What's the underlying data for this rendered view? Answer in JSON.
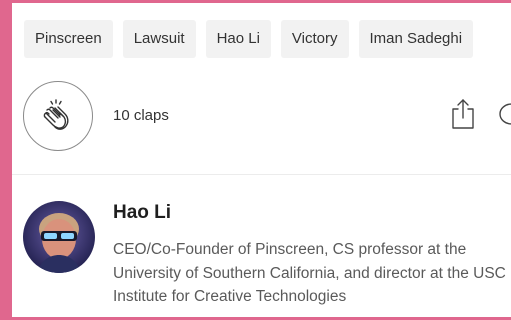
{
  "tags": [
    "Pinscreen",
    "Lawsuit",
    "Hao Li",
    "Victory",
    "Iman Sadeghi"
  ],
  "claps": {
    "count_label": "10 claps"
  },
  "icons": {
    "clap": "clap-hands-icon",
    "share": "share-icon",
    "comment": "comment-icon"
  },
  "author": {
    "name": "Hao Li",
    "bio": "CEO/Co-Founder of Pinscreen, CS professor at the University of Southern California, and director at the USC Institute for Creative Technologies"
  },
  "colors": {
    "frame": "#e0678e",
    "tag_bg": "#f2f2f2"
  }
}
